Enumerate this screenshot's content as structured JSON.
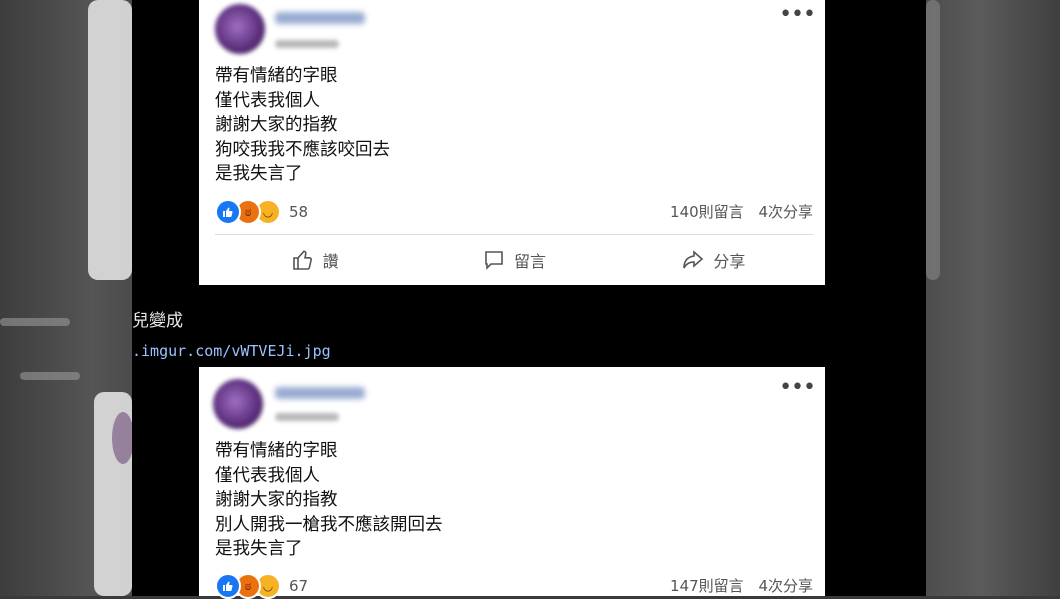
{
  "posts": [
    {
      "lines": [
        "帶有情緒的字眼",
        "僅代表我個人",
        "謝謝大家的指教",
        "狗咬我我不應該咬回去",
        "是我失言了"
      ],
      "reaction_count": "58",
      "comments": "140則留言",
      "shares": "4次分享",
      "actions": {
        "like": "讚",
        "comment": "留言",
        "share": "分享"
      }
    },
    {
      "lines": [
        "帶有情緒的字眼",
        "僅代表我個人",
        "謝謝大家的指教",
        "別人開我一槍我不應該開回去",
        "是我失言了"
      ],
      "reaction_count": "67",
      "comments": "147則留言",
      "shares": "4次分享"
    }
  ],
  "between": {
    "text": "兒變成",
    "link": ".imgur.com/vWTVEJi.jpg"
  },
  "colors": {
    "like": "#1877f2",
    "angry": "#e9710f",
    "haha": "#f7b125",
    "link": "#9bc1ff"
  },
  "icons": [
    "thumbs-up-icon",
    "comment-bubble-icon",
    "share-arrow-icon",
    "more-dots-icon"
  ]
}
